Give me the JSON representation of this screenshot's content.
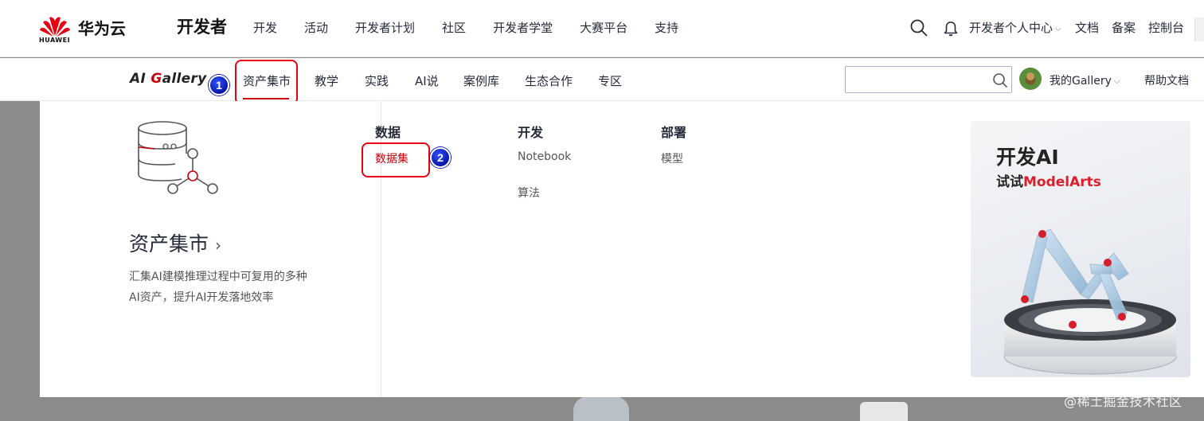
{
  "header": {
    "logo_text": "HUAWEI",
    "brand": "华为云",
    "section_title": "开发者",
    "nav": [
      "开发",
      "活动",
      "开发者计划",
      "社区",
      "开发者学堂",
      "大赛平台",
      "支持"
    ],
    "icons": [
      "search-icon",
      "bell-icon"
    ],
    "personal_center": "开发者个人中心",
    "docs": "文档",
    "filing": "备案",
    "console": "控制台"
  },
  "subheader": {
    "logo": "AI Gallery",
    "active_tab": "资产集市",
    "tabs": [
      "资产集市",
      "教学",
      "实践",
      "AI说",
      "案例库",
      "生态合作",
      "专区"
    ],
    "search_placeholder": "",
    "my_gallery": "我的Gallery",
    "help_docs": "帮助文档"
  },
  "annotations": {
    "step1": "1",
    "step2": "2",
    "accent_color": "#e60012"
  },
  "dropdown": {
    "title": "资产集市",
    "title_arrow": "›",
    "description": "汇集AI建模推理过程中可复用的多种AI资产，提升AI开发落地效率",
    "columns": [
      {
        "heading": "数据",
        "items": [
          "数据集"
        ]
      },
      {
        "heading": "开发",
        "items": [
          "Notebook",
          "算法"
        ]
      },
      {
        "heading": "部署",
        "items": [
          "模型"
        ]
      }
    ],
    "promo": {
      "title": "开发AI",
      "subtitle_prefix": "试试",
      "subtitle_accent": "ModelArts"
    }
  },
  "watermark": "@稀土掘金技术社区",
  "colors": {
    "brand_red": "#c7000b",
    "text": "#252b3a",
    "overlay": "#8b8b8b"
  }
}
